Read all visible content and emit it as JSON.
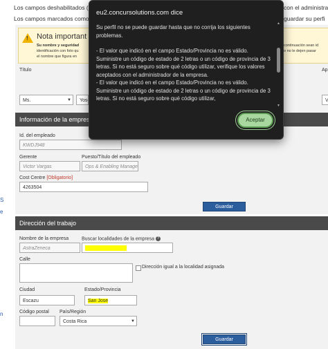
{
  "top": {
    "line1_left": "Los campos deshabilitados (",
    "line1_right": "con el administra",
    "line2_left": "Los campos marcados como",
    "line2_right": "guardar su perfi"
  },
  "left_links": {
    "s": "S",
    "e": "e",
    "n": "n"
  },
  "note": {
    "title": "Nota important",
    "text_line1": "Su nombre y seguridad",
    "text_line2": "identificación con foto qu",
    "text_line3": "el nombre que figura en",
    "right_line1": "continuación sean id",
    "right_line2": "o no le dejen pasar"
  },
  "name_row": {
    "titulo_label": "Título",
    "titulo_value": "Ms.",
    "nombre_value": "Yose",
    "ap_label": "Ap",
    "ap_value": "Vi"
  },
  "dialog": {
    "title": "eu2.concursolutions.com dice",
    "paragraph1": "Su perfil no se puede guardar hasta que no corrija los siguientes problemas.",
    "paragraph2": "- El valor que indicó en el campo Estado/Provincia no es válido. Suministre un código de estado de 2 letras o un código de provincia de 3 letras. Si no está seguro sobre qué código utilizar, verifique los valores aceptados con el administrador de la empresa.",
    "paragraph3": "- El valor que indicó en el campo Estado/Provincia no es válido. Suministre un código de estado de 2 letras o un código de provincia de 3 letras. Si no está seguro sobre qué código utilizar,",
    "accept_label": "Aceptar"
  },
  "company_info": {
    "header": "Información de la empresa",
    "employee_id_label": "Id. del empleado",
    "employee_id_value": "KWDJ948",
    "manager_label": "Gerente",
    "manager_value": "Victor Vargas",
    "position_label": "Puesto/Título del empleado",
    "position_value": "Ops & Enabling Manager",
    "cost_centre_label": "Cost Centre",
    "cost_centre_required": "[Obligatorio]",
    "cost_centre_value": "4263504",
    "save_label": "Guardar"
  },
  "work_address": {
    "header": "Dirección del trabajo",
    "company_name_label": "Nombre de la empresa",
    "company_name_value": "AstraZeneca",
    "search_label": "Buscar localidades de la empresa",
    "search_value": "",
    "street_label": "Calle",
    "street_value": "",
    "same_address_label": "Dirección igual a la localidad asignada",
    "city_label": "Ciudad",
    "city_value": "Escazu",
    "state_label": "Estado/Provincia",
    "state_value": "San Jose",
    "postal_label": "Código postal",
    "postal_value": "",
    "country_label": "País/Región",
    "country_value": "Costa Rica",
    "save_label": "Guardar"
  },
  "colors": {
    "panel_header": "#4a4a4a",
    "button": "#2c5e9e",
    "highlight": "#ffff00",
    "dialog_bg": "#1f1f1f",
    "accept_bg": "#a8d8a0"
  }
}
